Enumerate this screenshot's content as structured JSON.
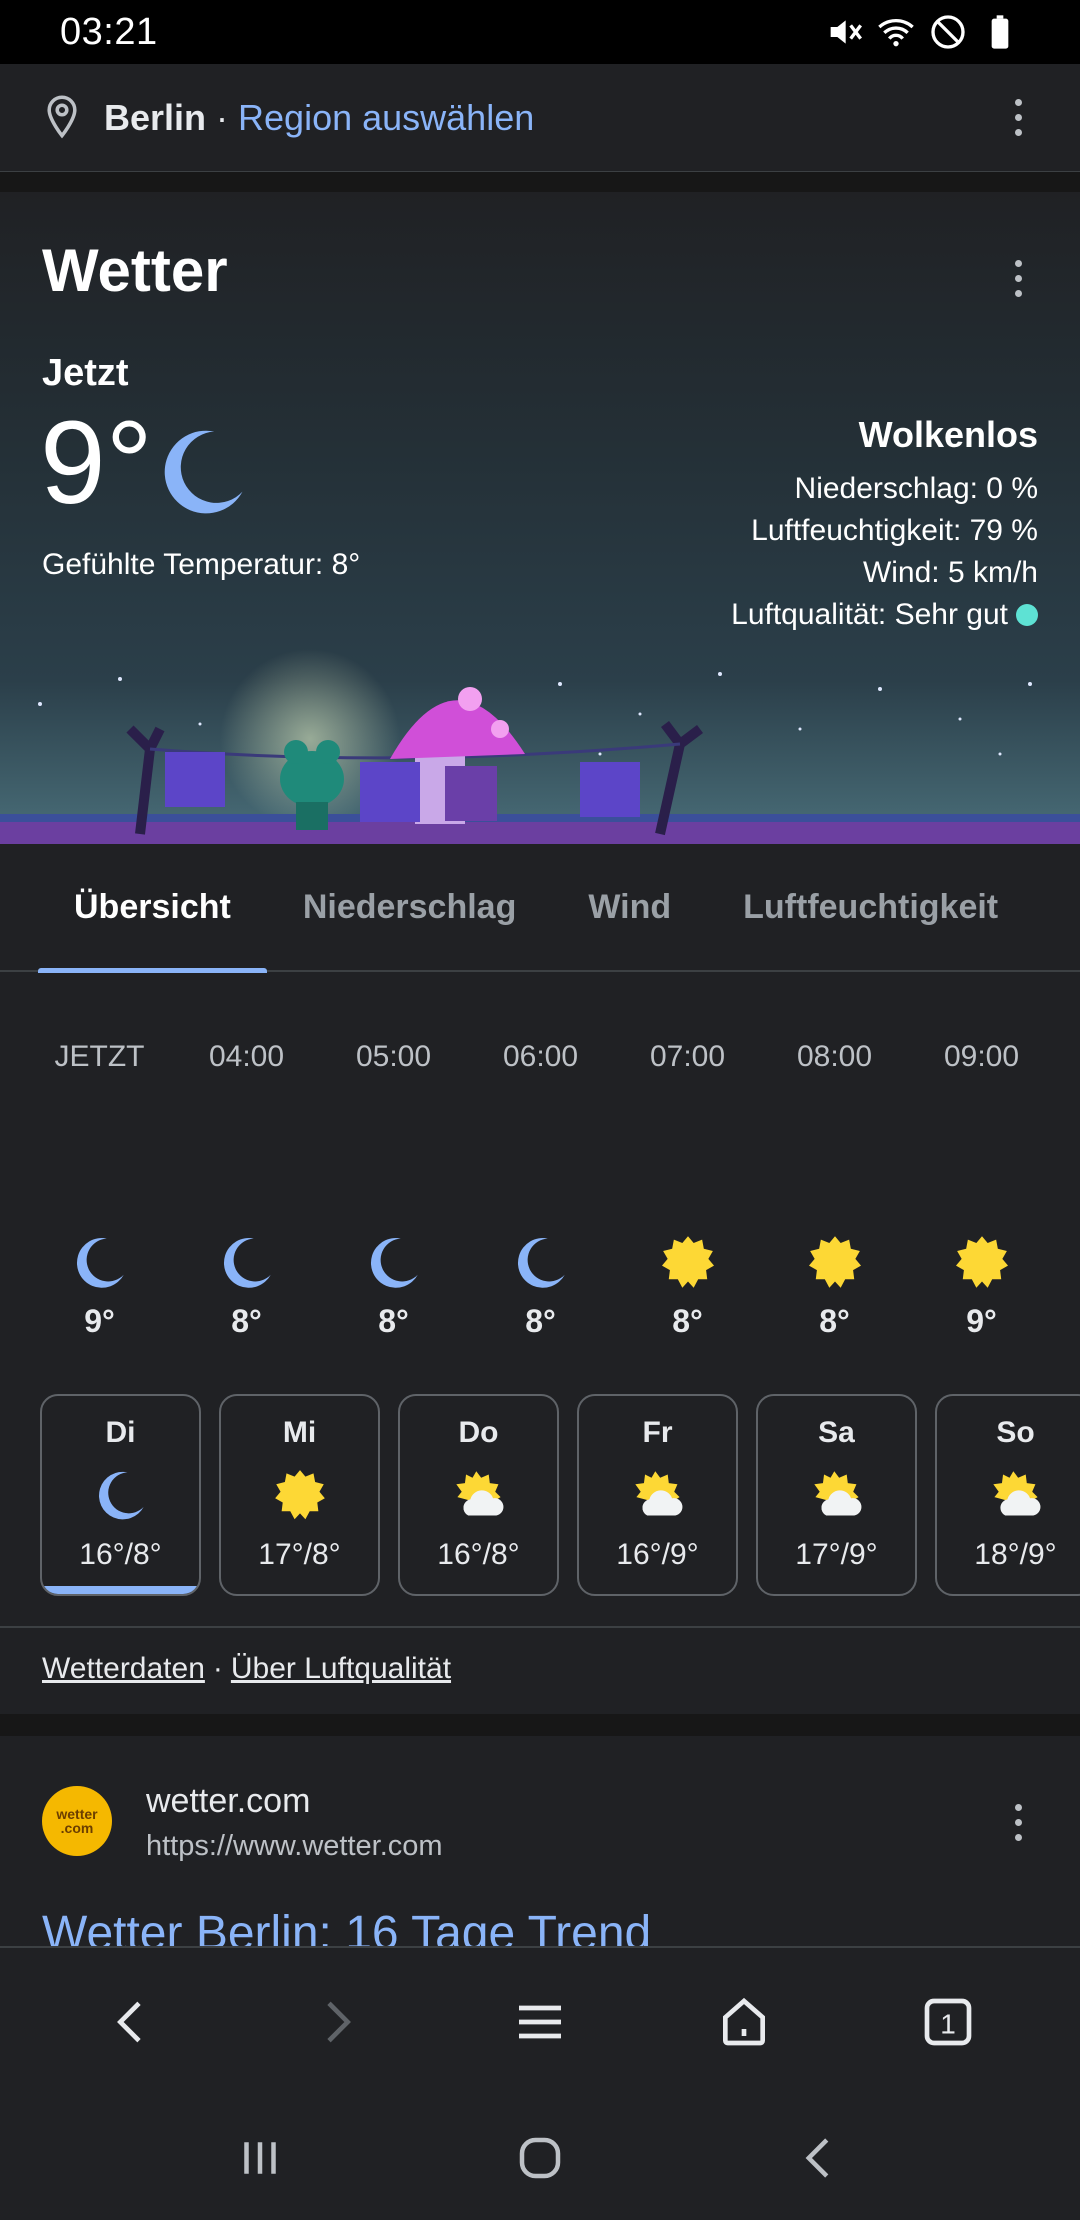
{
  "status_bar": {
    "time": "03:21"
  },
  "location": {
    "city": "Berlin",
    "separator": "·",
    "region_link": "Region auswählen"
  },
  "weather": {
    "title": "Wetter",
    "now_label": "Jetzt",
    "temperature": "9°",
    "feels_like": "Gefühlte Temperatur: 8°",
    "condition": "Wolkenlos",
    "precipitation": "Niederschlag: 0 %",
    "humidity": "Luftfeuchtigkeit: 79 %",
    "wind": "Wind: 5 km/h",
    "air_quality": "Luftqualität: Sehr gut",
    "air_quality_color": "#5ee2d4"
  },
  "tabs": [
    "Übersicht",
    "Niederschlag",
    "Wind",
    "Luftfeuchtigkeit"
  ],
  "hourly": [
    {
      "time": "JETZT",
      "icon": "moon-icon",
      "temp": "9°"
    },
    {
      "time": "04:00",
      "icon": "moon-icon",
      "temp": "8°"
    },
    {
      "time": "05:00",
      "icon": "moon-icon",
      "temp": "8°"
    },
    {
      "time": "06:00",
      "icon": "moon-icon",
      "temp": "8°"
    },
    {
      "time": "07:00",
      "icon": "sun-icon",
      "temp": "8°"
    },
    {
      "time": "08:00",
      "icon": "sun-icon",
      "temp": "8°"
    },
    {
      "time": "09:00",
      "icon": "sun-icon",
      "temp": "9°"
    }
  ],
  "daily": [
    {
      "day": "Di",
      "icon": "moon-icon",
      "temp": "16°/8°"
    },
    {
      "day": "Mi",
      "icon": "sun-icon",
      "temp": "17°/8°"
    },
    {
      "day": "Do",
      "icon": "partly-cloudy-icon",
      "temp": "16°/8°"
    },
    {
      "day": "Fr",
      "icon": "partly-cloudy-icon",
      "temp": "16°/9°"
    },
    {
      "day": "Sa",
      "icon": "partly-cloudy-icon",
      "temp": "17°/9°"
    },
    {
      "day": "So",
      "icon": "partly-cloudy-icon",
      "temp": "18°/9°"
    }
  ],
  "links": {
    "weather_data": "Wetterdaten",
    "separator": "·",
    "air_quality": "Über Luftqualität"
  },
  "result": {
    "favicon_text": "wetter .com",
    "site_name": "wetter.com",
    "url": "https://www.wetter.com",
    "title": "Wetter Berlin: 16 Tage Trend"
  },
  "toolbar": {
    "tab_count": "1"
  },
  "colors": {
    "accent": "#8ab4f8",
    "sun": "#fdd835",
    "moon": "#8ab4f8"
  }
}
